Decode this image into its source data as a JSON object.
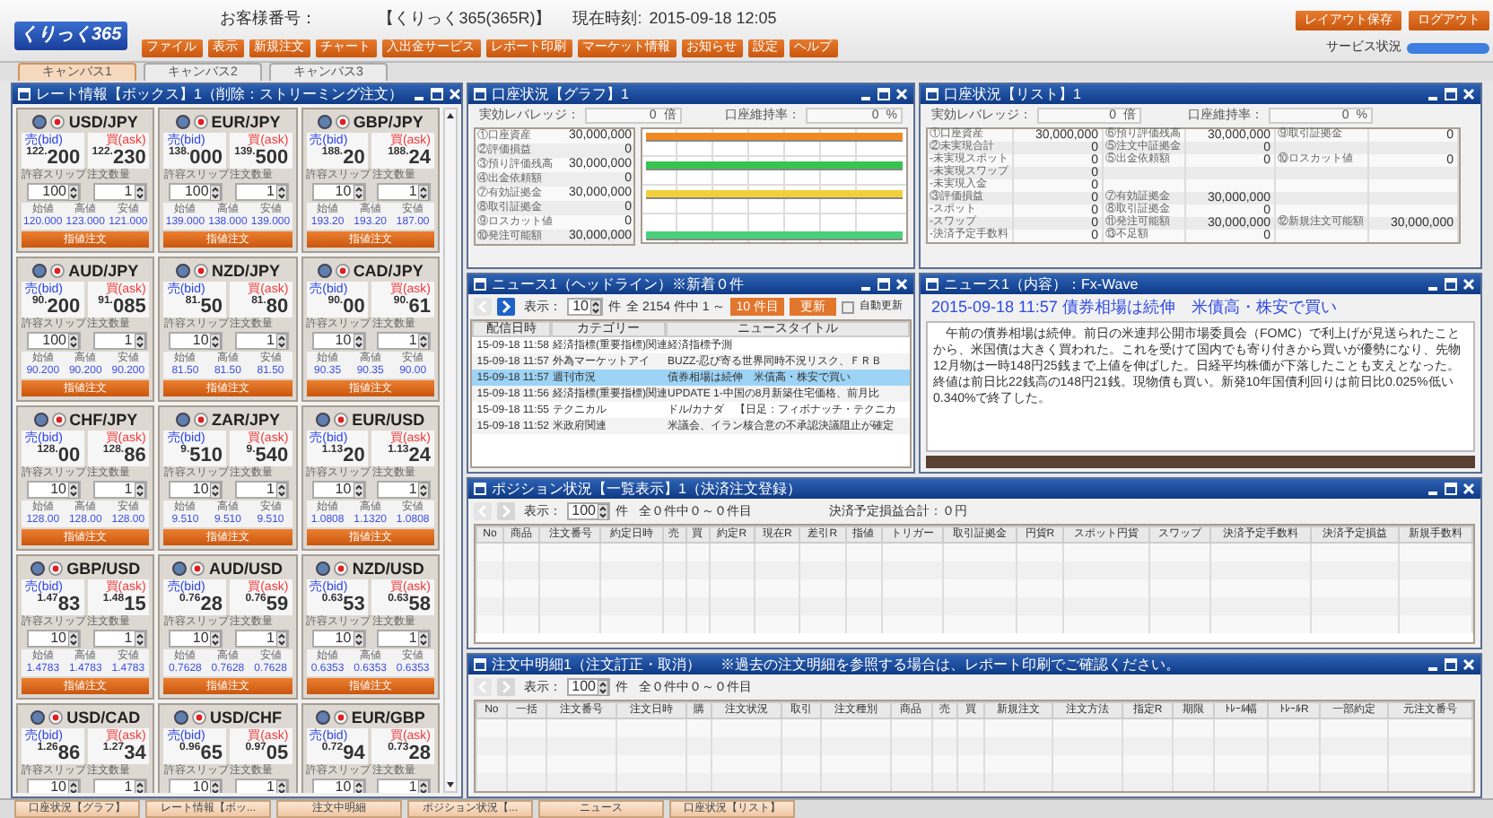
{
  "header": {
    "logo": "くりっく365",
    "customer_label": "お客様番号：",
    "product": "【くりっく365(365R)】",
    "time_label": "現在時刻:",
    "time": "2015-09-18 12:05",
    "menu": [
      "ファイル",
      "表示",
      "新規注文",
      "チャート",
      "入出金サービス",
      "レポート印刷",
      "マーケット情報",
      "お知らせ",
      "設定",
      "ヘルプ"
    ],
    "buttons": [
      "レイアウト保存",
      "ログアウト"
    ],
    "service_label": "サービス状況"
  },
  "canvas_tabs": [
    {
      "label": "キャンバス1",
      "selected": true
    },
    {
      "label": "キャンバス2",
      "selected": false
    },
    {
      "label": "キャンバス3",
      "selected": false
    }
  ],
  "rate_panel": {
    "title": "レート情報【ボックス】1（削除：ストリーミング注文）",
    "cards": [
      {
        "pair": "USD/JPY",
        "bid_label": "売(bid)",
        "ask_label": "買(ask)",
        "bid_big": "122.",
        "bid_pips": "200",
        "ask_big": "122.",
        "ask_pips": "230",
        "slip_label": "許容スリップ",
        "qty_label": "注文数量",
        "slip": "100",
        "qty": "1",
        "open_label": "始値",
        "high_label": "高値",
        "low_label": "安値",
        "open": "120.000",
        "high": "123.000",
        "low": "121.000",
        "order_button": "指値注文"
      },
      {
        "pair": "EUR/JPY",
        "bid_label": "売(bid)",
        "ask_label": "買(ask)",
        "bid_big": "138.",
        "bid_pips": "000",
        "ask_big": "139.",
        "ask_pips": "500",
        "slip_label": "許容スリップ",
        "qty_label": "注文数量",
        "slip": "100",
        "qty": "1",
        "open_label": "始値",
        "high_label": "高値",
        "low_label": "安値",
        "open": "139.000",
        "high": "138.000",
        "low": "139.000",
        "order_button": "指値注文"
      },
      {
        "pair": "GBP/JPY",
        "bid_label": "売(bid)",
        "ask_label": "買(ask)",
        "bid_big": "188.",
        "bid_pips": "20",
        "ask_big": "188.",
        "ask_pips": "24",
        "slip_label": "許容スリップ",
        "qty_label": "注文数量",
        "slip": "10",
        "qty": "1",
        "open_label": "始値",
        "high_label": "高値",
        "low_label": "安値",
        "open": "193.20",
        "high": "193.20",
        "low": "187.00",
        "order_button": "指値注文"
      },
      {
        "pair": "AUD/JPY",
        "bid_label": "売(bid)",
        "ask_label": "買(ask)",
        "bid_big": "90.",
        "bid_pips": "200",
        "ask_big": "91.",
        "ask_pips": "085",
        "slip_label": "許容スリップ",
        "qty_label": "注文数量",
        "slip": "100",
        "qty": "1",
        "open_label": "始値",
        "high_label": "高値",
        "low_label": "安値",
        "open": "90.200",
        "high": "90.200",
        "low": "90.200",
        "order_button": "指値注文"
      },
      {
        "pair": "NZD/JPY",
        "bid_label": "売(bid)",
        "ask_label": "買(ask)",
        "bid_big": "81.",
        "bid_pips": "50",
        "ask_big": "81.",
        "ask_pips": "80",
        "slip_label": "許容スリップ",
        "qty_label": "注文数量",
        "slip": "10",
        "qty": "1",
        "open_label": "始値",
        "high_label": "高値",
        "low_label": "安値",
        "open": "81.50",
        "high": "81.50",
        "low": "81.50",
        "order_button": "指値注文"
      },
      {
        "pair": "CAD/JPY",
        "bid_label": "売(bid)",
        "ask_label": "買(ask)",
        "bid_big": "90.",
        "bid_pips": "00",
        "ask_big": "90.",
        "ask_pips": "61",
        "slip_label": "許容スリップ",
        "qty_label": "注文数量",
        "slip": "10",
        "qty": "1",
        "open_label": "始値",
        "high_label": "高値",
        "low_label": "安値",
        "open": "90.35",
        "high": "90.35",
        "low": "90.00",
        "order_button": "指値注文"
      },
      {
        "pair": "CHF/JPY",
        "bid_label": "売(bid)",
        "ask_label": "買(ask)",
        "bid_big": "128.",
        "bid_pips": "00",
        "ask_big": "128.",
        "ask_pips": "86",
        "slip_label": "許容スリップ",
        "qty_label": "注文数量",
        "slip": "10",
        "qty": "1",
        "open_label": "始値",
        "high_label": "高値",
        "low_label": "安値",
        "open": "128.00",
        "high": "128.00",
        "low": "128.00",
        "order_button": "指値注文"
      },
      {
        "pair": "ZAR/JPY",
        "bid_label": "売(bid)",
        "ask_label": "買(ask)",
        "bid_big": "9.",
        "bid_pips": "510",
        "ask_big": "9.",
        "ask_pips": "540",
        "slip_label": "許容スリップ",
        "qty_label": "注文数量",
        "slip": "10",
        "qty": "1",
        "open_label": "始値",
        "high_label": "高値",
        "low_label": "安値",
        "open": "9.510",
        "high": "9.510",
        "low": "9.510",
        "order_button": "指値注文"
      },
      {
        "pair": "EUR/USD",
        "bid_label": "売(bid)",
        "ask_label": "買(ask)",
        "bid_big": "1.13",
        "bid_pips": "20",
        "ask_big": "1.13",
        "ask_pips": "24",
        "slip_label": "許容スリップ",
        "qty_label": "注文数量",
        "slip": "10",
        "qty": "1",
        "open_label": "始値",
        "high_label": "高値",
        "low_label": "安値",
        "open": "1.0808",
        "high": "1.1320",
        "low": "1.0808",
        "order_button": "指値注文"
      },
      {
        "pair": "GBP/USD",
        "bid_label": "売(bid)",
        "ask_label": "買(ask)",
        "bid_big": "1.47",
        "bid_pips": "83",
        "ask_big": "1.48",
        "ask_pips": "15",
        "slip_label": "許容スリップ",
        "qty_label": "注文数量",
        "slip": "10",
        "qty": "1",
        "open_label": "始値",
        "high_label": "高値",
        "low_label": "安値",
        "open": "1.4783",
        "high": "1.4783",
        "low": "1.4783",
        "order_button": "指値注文"
      },
      {
        "pair": "AUD/USD",
        "bid_label": "売(bid)",
        "ask_label": "買(ask)",
        "bid_big": "0.76",
        "bid_pips": "28",
        "ask_big": "0.76",
        "ask_pips": "59",
        "slip_label": "許容スリップ",
        "qty_label": "注文数量",
        "slip": "10",
        "qty": "1",
        "open_label": "始値",
        "high_label": "高値",
        "low_label": "安値",
        "open": "0.7628",
        "high": "0.7628",
        "low": "0.7628",
        "order_button": "指値注文"
      },
      {
        "pair": "NZD/USD",
        "bid_label": "売(bid)",
        "ask_label": "買(ask)",
        "bid_big": "0.63",
        "bid_pips": "53",
        "ask_big": "0.63",
        "ask_pips": "58",
        "slip_label": "許容スリップ",
        "qty_label": "注文数量",
        "slip": "10",
        "qty": "1",
        "open_label": "始値",
        "high_label": "高値",
        "low_label": "安値",
        "open": "0.6353",
        "high": "0.6353",
        "low": "0.6353",
        "order_button": "指値注文"
      },
      {
        "pair": "USD/CAD",
        "bid_label": "売(bid)",
        "ask_label": "買(ask)",
        "bid_big": "1.26",
        "bid_pips": "86",
        "ask_big": "1.27",
        "ask_pips": "34",
        "slip_label": "許容スリップ",
        "qty_label": "注文数量",
        "slip": "10",
        "qty": "1"
      },
      {
        "pair": "USD/CHF",
        "bid_label": "売(bid)",
        "ask_label": "買(ask)",
        "bid_big": "0.96",
        "bid_pips": "65",
        "ask_big": "0.97",
        "ask_pips": "05",
        "slip_label": "許容スリップ",
        "qty_label": "注文数量",
        "slip": "10",
        "qty": "1"
      },
      {
        "pair": "EUR/GBP",
        "bid_label": "売(bid)",
        "ask_label": "買(ask)",
        "bid_big": "0.72",
        "bid_pips": "94",
        "ask_big": "0.73",
        "ask_pips": "28",
        "slip_label": "許容スリップ",
        "qty_label": "注文数量",
        "slip": "10",
        "qty": "1"
      }
    ]
  },
  "graph_panel": {
    "title": "口座状況【グラフ】1",
    "leverage_label": "実効レバレッジ：",
    "leverage": "0",
    "leverage_unit": "倍",
    "ratio_label": "口座維持率：",
    "ratio": "0",
    "ratio_unit": "%",
    "rows": [
      [
        "①口座資産",
        "30,000,000"
      ],
      [
        "②評価損益",
        "0"
      ],
      [
        "③預り評価残高",
        "30,000,000"
      ],
      [
        "④出金依頼額",
        "0"
      ],
      [
        "⑦有効証拠金",
        "30,000,000"
      ],
      [
        "⑧取引証拠金",
        "0"
      ],
      [
        "⑨ロスカット値",
        "0"
      ],
      [
        "⑩発注可能額",
        "30,000,000"
      ]
    ]
  },
  "list_panel": {
    "title": "口座状況【リスト】1",
    "leverage_label": "実効レバレッジ：",
    "leverage": "0",
    "leverage_unit": "倍",
    "ratio_label": "口座維持率：",
    "ratio": "0",
    "ratio_unit": "%",
    "rows": [
      [
        "①口座資産",
        "30,000,000",
        "⑥預り評価残高",
        "30,000,000",
        "⑨取引証拠金",
        "0"
      ],
      [
        "②未実現合計",
        "0",
        "⑤注文中証拠金",
        "0",
        "",
        ""
      ],
      [
        "-未実現スポット",
        "0",
        "⑤出金依頼額",
        "0",
        "⑩ロスカット値",
        "0"
      ],
      [
        "-未実現スワップ",
        "0",
        "",
        "",
        "",
        ""
      ],
      [
        "-未実現入金",
        "0",
        "",
        "",
        "",
        ""
      ],
      [
        "③評価損益",
        "0",
        "⑦有効証拠金",
        "30,000,000",
        "",
        ""
      ],
      [
        "-スポット",
        "0",
        "⑧取引証拠金",
        "0",
        "",
        ""
      ],
      [
        "-スワップ",
        "0",
        "⑪発注可能額",
        "30,000,000",
        "⑫新規注文可能額",
        "30,000,000"
      ],
      [
        "-決済予定手数料",
        "0",
        "⑬不足額",
        "0",
        "",
        ""
      ]
    ]
  },
  "headline_panel": {
    "title": "ニュース1（ヘッドライン）※新着０件",
    "show_label": "表示：",
    "count": "10",
    "unit": "件",
    "range": "全 2154 件中 1 ～",
    "page_button": "10 件目",
    "refresh_button": "更新",
    "auto_refresh": {
      "label": "自動更新",
      "checked": false
    },
    "columns": [
      "配信日時",
      "カテゴリー",
      "ニュースタイトル"
    ],
    "rows": [
      {
        "cells": [
          "15-09-18 11:58",
          "経済指標(重要指標)関連",
          "経済指標予測"
        ],
        "selected": false
      },
      {
        "cells": [
          "15-09-18 11:57",
          "外為マーケットアイ",
          "BUZZ-忍び寄る世界同時不況リスク、ＦＲＢ"
        ],
        "selected": false
      },
      {
        "cells": [
          "15-09-18 11:57",
          "週刊市況",
          "債券相場は続伸　米債高・株安で買い"
        ],
        "selected": true
      },
      {
        "cells": [
          "15-09-18 11:56",
          "経済指標(重要指標)関連",
          "UPDATE 1-中国の8月新築住宅価格、前月比"
        ],
        "selected": false
      },
      {
        "cells": [
          "15-09-18 11:55",
          "テクニカル",
          "ドル/カナダ　【日足：フィボナッチ・テクニカ"
        ],
        "selected": false
      },
      {
        "cells": [
          "15-09-18 11:52",
          "米政府関連",
          "米議会、イラン核合意の不承認決議阻止が確定"
        ],
        "selected": false
      }
    ]
  },
  "content_panel": {
    "title": "ニュース1（内容）：Fx-Wave",
    "headline": "2015-09-18 11:57 債券相場は続伸　米債高・株安で買い",
    "body": "　午前の債券相場は続伸。前日の米連邦公開市場委員会（FOMC）で利上げが見送られたことから、米国債は大きく買われた。これを受けて国内でも寄り付きから買いが優勢になり、先物12月物は一時148円25銭まで上値を伸ばした。日経平均株価が下落したことも支えとなった。終値は前日比22銭高の148円21銭。現物債も買い。新発10年国債利回りは前日比0.025%低い0.340%で終了した。"
  },
  "position_panel": {
    "title": "ポジション状況【一覧表示】1（決済注文登録）",
    "show_label": "表示：",
    "count": "100",
    "unit": "件",
    "range": "全０件中０～０件目",
    "total": "決済予定損益合計：０円",
    "columns": [
      "No",
      "商品",
      "注文番号",
      "約定日時",
      "売",
      "買",
      "約定R",
      "現在R",
      "差引R",
      "指値",
      "トリガー",
      "取引証拠金",
      "円貨R",
      "スポット円貨",
      "スワップ",
      "決済予定手数料",
      "決済予定損益",
      "新規手数料"
    ]
  },
  "orders_panel": {
    "title": "注文中明細1（注文訂正・取消）",
    "note": "※過去の注文明細を参照する場合は、レポート印刷でご確認ください。",
    "show_label": "表示：",
    "count": "100",
    "unit": "件",
    "range": "全０件中０～０件目",
    "columns": [
      "No",
      "一括",
      "注文番号",
      "注文日時",
      "購",
      "注文状況",
      "取引",
      "注文種別",
      "商品",
      "売",
      "買",
      "新規注文",
      "注文方法",
      "指定R",
      "期限",
      "ﾄﾚｰﾙ幅",
      "ﾄﾚｰﾙR",
      "一部約定",
      "元注文番号"
    ]
  },
  "taskbar": [
    "口座状況【グラフ】",
    "レート情報【ボッ...",
    "注文中明細",
    "ポジション状況【...",
    "ニュース",
    "口座状況【リスト】"
  ]
}
